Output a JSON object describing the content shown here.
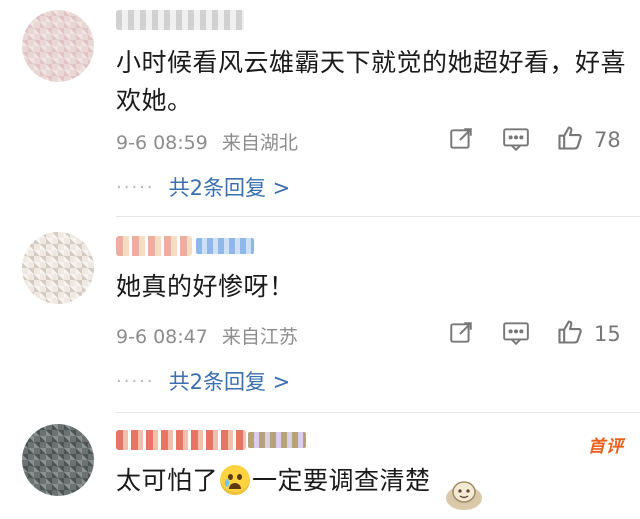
{
  "comments": [
    {
      "text": "小时候看风云雄霸天下就觉的她超好看，好喜欢她。",
      "time": "9-6 08:59",
      "location": "来自湖北",
      "likes": "78",
      "replies_label": "共2条回复 >"
    },
    {
      "text": "她真的好惨呀！",
      "time": "9-6 08:47",
      "location": "来自江苏",
      "likes": "15",
      "replies_label": "共2条回复 >"
    },
    {
      "text_before": "太可怕了",
      "text_after": "一定要调查清楚",
      "first_label": "首评"
    }
  ],
  "icons": {
    "share": "share-icon",
    "comment": "comment-icon",
    "like": "thumbs-up-icon",
    "emoji": "crying-face-emoji"
  },
  "colors": {
    "reply_link": "#3a6fb0",
    "meta": "#8d8d8d",
    "first_comment": "#e8611e"
  }
}
